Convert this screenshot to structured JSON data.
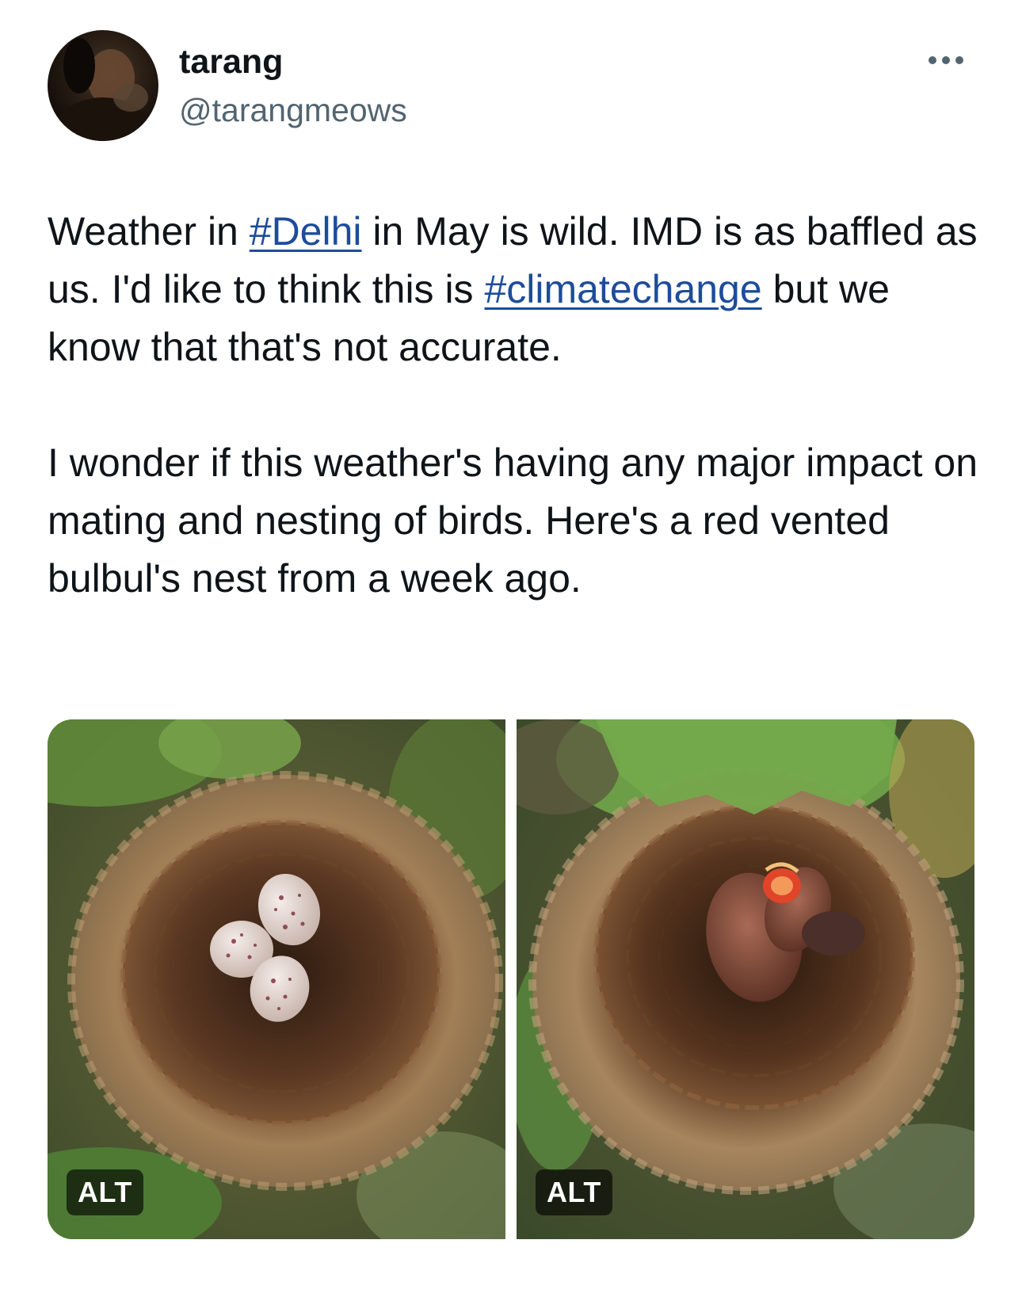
{
  "author": {
    "display_name": "tarang",
    "handle": "@tarangmeows",
    "avatar_icon": "profile-photo"
  },
  "more_icon": "more-dots-icon",
  "tweet": {
    "p1_before_1": "Weather in ",
    "hashtag_1": "#Delhi",
    "p1_middle": " in May is wild. IMD is as baffled as us. I'd like to think this is ",
    "hashtag_2": "#climatechange",
    "p1_after": " but we know that that's not accurate.",
    "p2": "I wonder if this weather's having any major impact on mating and nesting of birds. Here's a red vented bulbul's nest from a week ago."
  },
  "media": {
    "photos": [
      {
        "content": "nest with three speckled eggs",
        "alt_label": "ALT"
      },
      {
        "content": "nest with hatchlings",
        "alt_label": "ALT"
      }
    ]
  },
  "colors": {
    "text": "#0f1419",
    "secondary": "#536471",
    "link": "#1d4c9b"
  }
}
